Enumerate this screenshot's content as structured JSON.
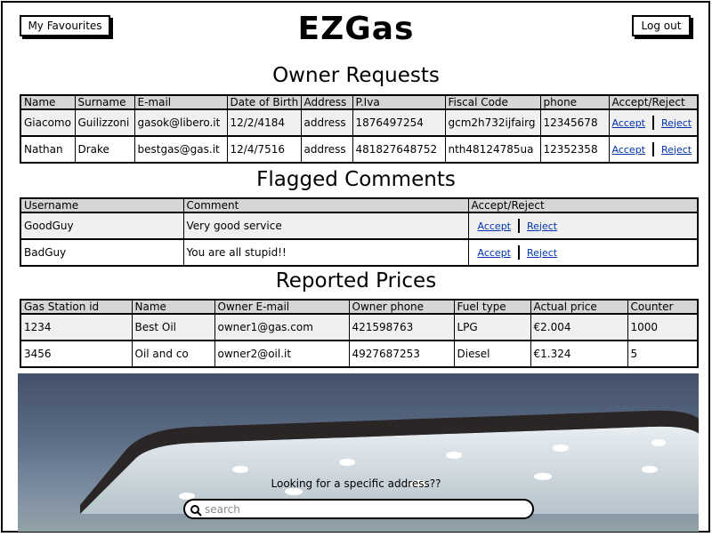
{
  "header": {
    "title": "EZGas",
    "favourites_label": "My Favourites",
    "logout_label": "Log out"
  },
  "owner_requests": {
    "title": "Owner Requests",
    "columns": [
      "Name",
      "Surname",
      "E-mail",
      "Date of Birth",
      "Address",
      "P.Iva",
      "Fiscal Code",
      "phone",
      "Accept/Reject"
    ],
    "rows": [
      {
        "name": "Giacomo",
        "surname": "Guilizzoni",
        "email": "gasok@libero.it",
        "dob": "12/2/4184",
        "address": "address",
        "piva": "1876497254",
        "fiscal": "gcm2h732ijfairg",
        "phone": "12345678",
        "accept": "Accept",
        "reject": "Reject"
      },
      {
        "name": "Nathan",
        "surname": "Drake",
        "email": "bestgas@gas.it",
        "dob": "12/4/7516",
        "address": "address",
        "piva": "481827648752",
        "fiscal": "nth48124785ua",
        "phone": "12352358",
        "accept": "Accept",
        "reject": "Reject"
      }
    ]
  },
  "flagged_comments": {
    "title": "Flagged Comments",
    "columns": [
      "Username",
      "Comment",
      "Accept/Reject"
    ],
    "rows": [
      {
        "username": "GoodGuy",
        "comment": "Very good service",
        "accept": "Accept",
        "reject": "Reject"
      },
      {
        "username": "BadGuy",
        "comment": "You are all stupid!!",
        "accept": "Accept",
        "reject": "Reject"
      }
    ]
  },
  "reported_prices": {
    "title": "Reported Prices",
    "columns": [
      "Gas Station id",
      "Name",
      "Owner E-mail",
      "Owner phone",
      "Fuel type",
      "Actual price",
      "Counter"
    ],
    "rows": [
      {
        "id": "1234",
        "name": "Best Oil",
        "email": "owner1@gas.com",
        "phone": "421598763",
        "fuel": "LPG",
        "price": "€2.004",
        "counter": "1000"
      },
      {
        "id": "3456",
        "name": "Oil and co",
        "email": "owner2@oil.it",
        "phone": "4927687253",
        "fuel": "Diesel",
        "price": "€1.324",
        "counter": "5"
      }
    ]
  },
  "search": {
    "prompt": "Looking for a specific address??",
    "placeholder": "search",
    "icon": "search-icon"
  },
  "colors": {
    "link": "#0033aa",
    "header_bg": "#d6d6d6",
    "row_bg": "#f0f0f0"
  }
}
